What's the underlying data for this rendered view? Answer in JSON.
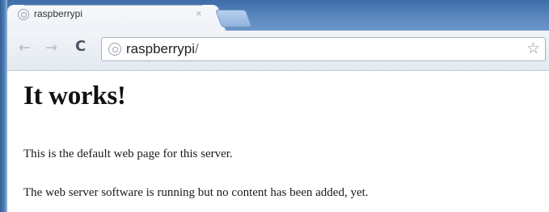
{
  "browser": {
    "tab": {
      "title": "raspberrypi",
      "close_icon": "×"
    },
    "toolbar": {
      "back_icon": "←",
      "forward_icon": "→",
      "reload_icon": "C",
      "address": {
        "host": "raspberrypi",
        "path": "/"
      },
      "star_icon": "☆"
    }
  },
  "page": {
    "heading": "It works!",
    "paragraphs": [
      "This is the default web page for this server.",
      "The web server software is running but no content has been added, yet."
    ]
  }
}
